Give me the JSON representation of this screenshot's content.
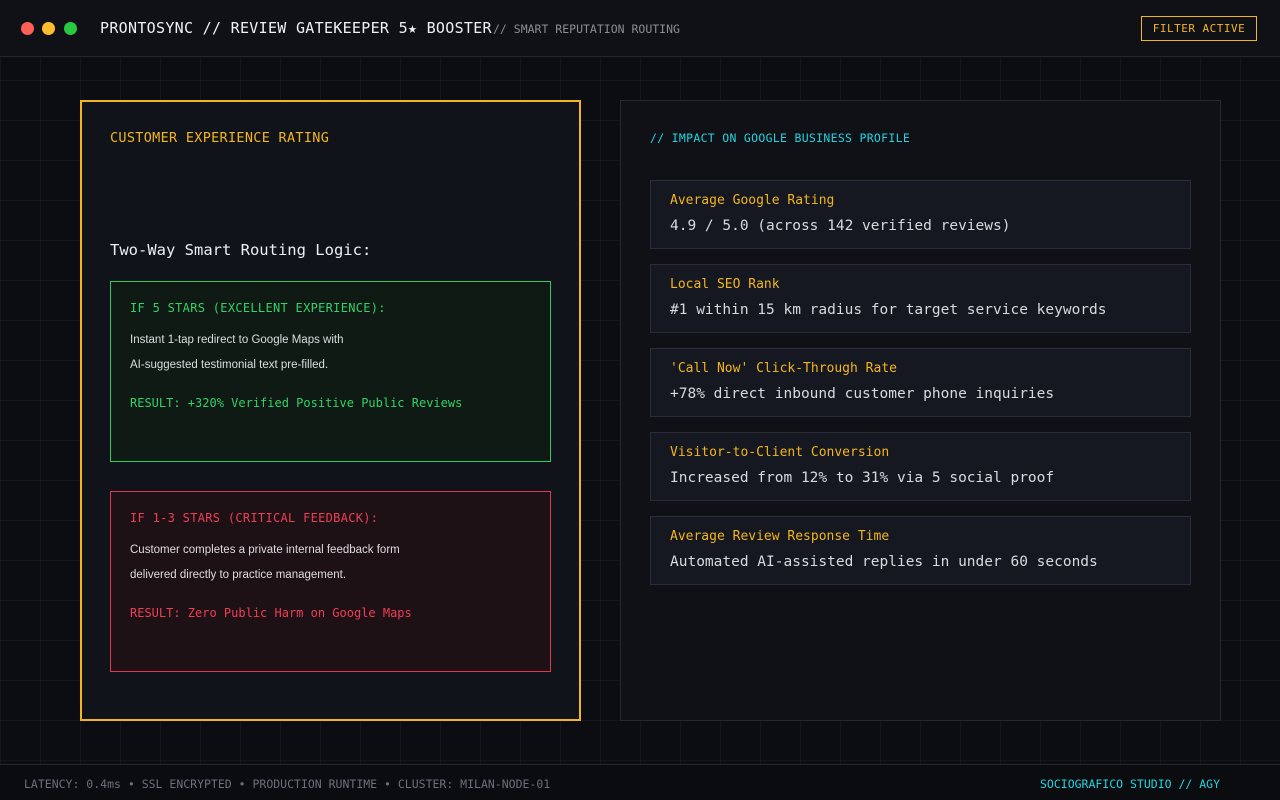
{
  "window": {
    "title": "PRONTOSYNC // REVIEW GATEKEEPER 5★ BOOSTER",
    "subtitle": "// SMART REPUTATION ROUTING",
    "filter_label": "FILTER ACTIVE"
  },
  "rating_panel": {
    "heading": "CUSTOMER EXPERIENCE RATING",
    "routing_title": "Two-Way Smart Routing Logic:",
    "positive": {
      "label": "IF 5 STARS (EXCELLENT EXPERIENCE):",
      "line1": "Instant 1-tap redirect to Google Maps with",
      "line2": "AI-suggested testimonial text pre-filled.",
      "result": "RESULT: +320% Verified Positive Public Reviews"
    },
    "negative": {
      "label": "IF 1-3 STARS (CRITICAL FEEDBACK):",
      "line1": "Customer completes a private internal feedback form",
      "line2": "delivered directly to practice management.",
      "result": "RESULT: Zero Public Harm on Google Maps"
    }
  },
  "impact_panel": {
    "heading": "// IMPACT ON GOOGLE BUSINESS PROFILE",
    "metrics": [
      {
        "label": "Average Google Rating",
        "value": "4.9 / 5.0 (across 142 verified reviews)"
      },
      {
        "label": "Local SEO Rank",
        "value": "#1 within 15 km radius for target service keywords"
      },
      {
        "label": "'Call Now' Click-Through Rate",
        "value": "+78% direct inbound customer phone inquiries"
      },
      {
        "label": "Visitor-to-Client Conversion",
        "value": "Increased from 12% to 31% via 5  social proof"
      },
      {
        "label": "Average Review Response Time",
        "value": "Automated AI-assisted replies in under 60 seconds"
      }
    ]
  },
  "statusbar": {
    "info": "LATENCY: 0.4ms • SSL ENCRYPTED • PRODUCTION RUNTIME • CLUSTER: MILAN-NODE-01",
    "studio": "SOCIOGRAFICO STUDIO // AGY"
  },
  "colors": {
    "accent": "#f2b51c",
    "positive": "#33d166",
    "negative": "#ee3e55",
    "info": "#21d4e0",
    "background": "#0c0d12"
  }
}
